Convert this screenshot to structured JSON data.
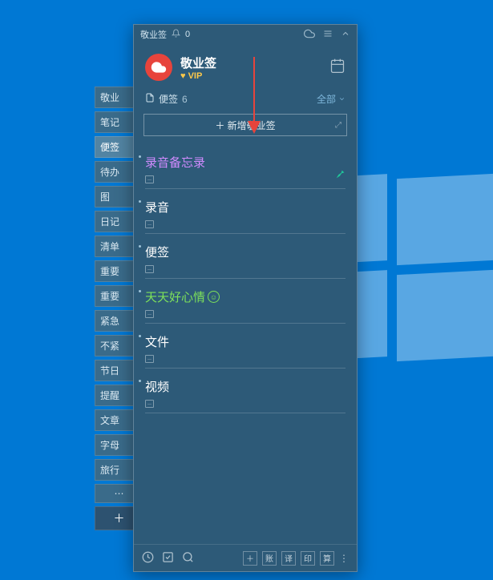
{
  "titlebar": {
    "app_name": "敬业签",
    "bell_count": "0"
  },
  "brand": {
    "name": "敬业签",
    "vip": "♥ VIP"
  },
  "section": {
    "label": "便签",
    "count": "6",
    "all": "全部"
  },
  "add_button": {
    "label": "＋ 新增敬业签"
  },
  "sidebar": {
    "items": [
      "敬业",
      "笔记",
      "便签",
      "待办",
      "图",
      "日记",
      "清单",
      "重要",
      "重要",
      "紧急",
      "不紧",
      "节日",
      "提醒",
      "文章",
      "字母",
      "旅行"
    ]
  },
  "notes": [
    {
      "title": "录音备忘录",
      "style": "purple"
    },
    {
      "title": "录音",
      "style": ""
    },
    {
      "title": "便签",
      "style": ""
    },
    {
      "title": "天天好心情",
      "style": "green"
    },
    {
      "title": "文件",
      "style": ""
    },
    {
      "title": "视频",
      "style": ""
    }
  ],
  "footer": {
    "btn_account": "账",
    "btn_translate": "译",
    "btn_print": "印",
    "btn_calc": "算"
  }
}
